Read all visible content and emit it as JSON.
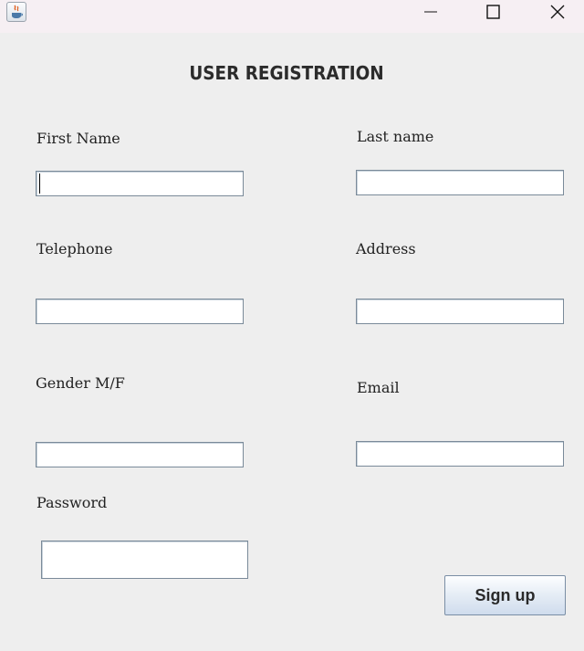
{
  "window": {
    "controls": {
      "minimize_icon": "minimize-icon",
      "maximize_icon": "maximize-icon",
      "close_icon": "close-icon"
    },
    "app_icon": "java-icon"
  },
  "form": {
    "title": "USER REGISTRATION",
    "fields": {
      "first_name": {
        "label": "First Name",
        "value": ""
      },
      "last_name": {
        "label": "Last name",
        "value": ""
      },
      "telephone": {
        "label": "Telephone",
        "value": ""
      },
      "address": {
        "label": "Address",
        "value": ""
      },
      "gender": {
        "label": "Gender M/F",
        "value": ""
      },
      "email": {
        "label": "Email",
        "value": ""
      },
      "password": {
        "label": "Password",
        "value": ""
      }
    },
    "submit_label": "Sign up"
  },
  "colors": {
    "background": "#eeeeee",
    "titlebar": "#f6eff3",
    "field_border": "#7a8a99"
  }
}
